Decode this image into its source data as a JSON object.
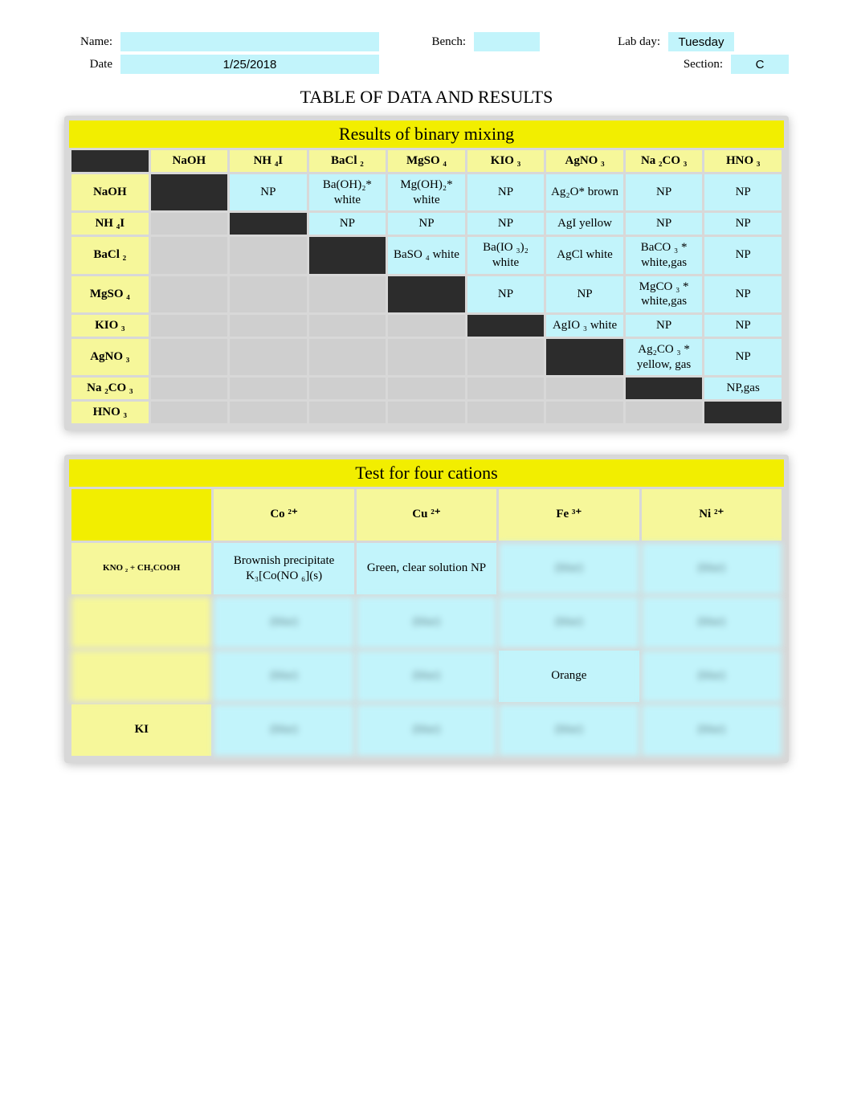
{
  "labels": {
    "name": "Name:",
    "date": "Date",
    "bench": "Bench:",
    "labday": "Lab day:",
    "section": "Section:"
  },
  "header": {
    "name": "",
    "date": "1/25/2018",
    "bench": "",
    "labday": "Tuesday",
    "section": "C"
  },
  "title": "TABLE OF DATA AND RESULTS",
  "binary": {
    "caption": "Results of binary mixing",
    "cols": [
      "NaOH",
      "NH ₄I",
      "BaCl ₂",
      "MgSO ₄",
      "KIO ₃",
      "AgNO ₃",
      "Na ₂CO ₃",
      "HNO ₃"
    ],
    "rows": [
      "NaOH",
      "NH ₄I",
      "BaCl ₂",
      "MgSO ₄",
      "KIO ₃",
      "AgNO ₃",
      "Na ₂CO ₃",
      "HNO ₃"
    ],
    "cells": {
      "NaOH_NH4I": "NP",
      "NaOH_BaCl2": "Ba(OH)₂* white",
      "NaOH_MgSO4": "Mg(OH)₂* white",
      "NaOH_KIO3": "NP",
      "NaOH_AgNO3": "Ag₂O* brown",
      "NaOH_Na2CO3": "NP",
      "NaOH_HNO3": "NP",
      "NH4I_BaCl2": "NP",
      "NH4I_MgSO4": "NP",
      "NH4I_KIO3": "NP",
      "NH4I_AgNO3": "AgI yellow",
      "NH4I_Na2CO3": "NP",
      "NH4I_HNO3": "NP",
      "BaCl2_MgSO4": "BaSO ₄ white",
      "BaCl2_KIO3": "Ba(IO ₃)₂ white",
      "BaCl2_AgNO3": "AgCl white",
      "BaCl2_Na2CO3": "BaCO ₃ * white,gas",
      "BaCl2_HNO3": "NP",
      "MgSO4_KIO3": "NP",
      "MgSO4_AgNO3": "NP",
      "MgSO4_Na2CO3": "MgCO ₃ * white,gas",
      "MgSO4_HNO3": "NP",
      "KIO3_AgNO3": "AgIO ₃ white",
      "KIO3_Na2CO3": "NP",
      "KIO3_HNO3": "NP",
      "AgNO3_Na2CO3": "Ag₂CO ₃ * yellow, gas",
      "AgNO3_HNO3": "NP",
      "Na2CO3_HNO3": "NP,gas"
    }
  },
  "cations": {
    "caption": "Test for four cations",
    "cols": [
      "Co ²⁺",
      "Cu ²⁺",
      "Fe ³⁺",
      "Ni ²⁺"
    ],
    "rows": [
      {
        "head": "KNO ₂ + CH₃COOH",
        "blurHead": false,
        "cells": [
          "Brownish precipitate K₃[Co(NO ₆](s)",
          "Green, clear solution NP",
          "(blur)",
          "(blur)"
        ]
      },
      {
        "head": "",
        "blurHead": true,
        "cells": [
          "(blur)",
          "(blur)",
          "(blur)",
          "(blur)"
        ]
      },
      {
        "head": "",
        "blurHead": true,
        "cells": [
          "(blur)",
          "(blur)",
          "Orange",
          "(blur)"
        ]
      },
      {
        "head": "KI",
        "blurHead": false,
        "cells": [
          "(blur)",
          "(blur)",
          "(blur)",
          "(blur)"
        ]
      }
    ]
  }
}
